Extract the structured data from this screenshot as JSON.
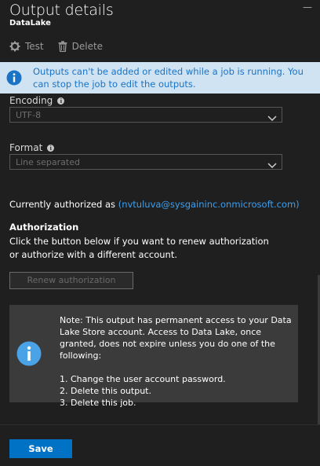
{
  "header": {
    "title": "Output details",
    "subtitle": "DataLake"
  },
  "toolbar": {
    "test_label": "Test",
    "delete_label": "Delete"
  },
  "info_bar": {
    "message": "Outputs can't be added or edited while a job is running. You can stop the job to edit the outputs."
  },
  "encoding": {
    "label": "Encoding",
    "value": "UTF-8"
  },
  "format": {
    "label": "Format",
    "value": "Line separated"
  },
  "authorized": {
    "prefix": "Currently authorized as",
    "email": "(nvtuluva@sysgaininc.onmicrosoft.com)"
  },
  "authorization": {
    "title": "Authorization",
    "description": "Click the button below if you want to renew authorization or authorize with a different account.",
    "renew_label": "Renew authorization"
  },
  "note": {
    "text": "Note: This output has permanent access to your Data Lake Store account. Access to Data Lake, once granted, does not expire unless you do one of the following:",
    "items": [
      "1. Change the user account password.",
      "2. Delete this output.",
      "3. Delete this job."
    ]
  },
  "footer": {
    "save_label": "Save"
  },
  "colors": {
    "background": "#1f1f1f",
    "info_bar_bg": "#cfe3f3",
    "info_bar_text": "#1b73c5",
    "link": "#3aa0f3",
    "primary_button": "#0072c6",
    "note_bg": "#3b3b3b"
  },
  "icons": {
    "test": "gear-icon",
    "delete": "trash-icon",
    "info": "info-icon",
    "dropdown": "chevron-down-icon"
  }
}
